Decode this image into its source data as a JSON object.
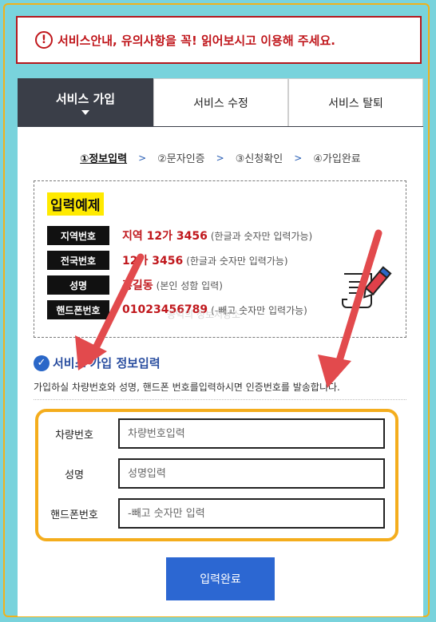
{
  "notice": {
    "icon": "exclamation-circle-icon",
    "text": "서비스안내, 유의사항을 꼭! 읽어보시고 이용해 주세요."
  },
  "tabs": [
    {
      "label": "서비스 가입",
      "active": true
    },
    {
      "label": "서비스 수정",
      "active": false
    },
    {
      "label": "서비스 탈퇴",
      "active": false
    }
  ],
  "steps": [
    {
      "label": "①정보입력",
      "active": true
    },
    {
      "label": "②문자인증",
      "active": false
    },
    {
      "label": "③신청확인",
      "active": false
    },
    {
      "label": "④가입완료",
      "active": false
    }
  ],
  "example": {
    "title": "입력예제",
    "rows": [
      {
        "label": "지역번호",
        "value": "지역 12가 3456",
        "note": "(한글과 숫자만 입력가능)"
      },
      {
        "label": "전국번호",
        "value": "12가 3456",
        "note": "(한글과 숫자만 입력가능)"
      },
      {
        "label": "성명",
        "value": "홍길동",
        "note": "(본인 성함 입력)"
      },
      {
        "label": "핸드폰번호",
        "value": "01023456789",
        "note": "(-빼고 숫자만 입력가능)"
      }
    ],
    "watermark": "공익의 정보저장소"
  },
  "section": {
    "title": "서비스 가입 정보입력",
    "description": "가입하실 차량번호와 성명, 핸드폰 번호를입력하시면 인증번호를 발송합니다."
  },
  "form": {
    "vehicle": {
      "label": "차량번호",
      "placeholder": "차량번호입력"
    },
    "name": {
      "label": "성명",
      "placeholder": "성명입력"
    },
    "phone": {
      "label": "핸드폰번호",
      "placeholder": "-빼고 숫자만 입력"
    },
    "submit_label": "입력완료"
  },
  "colors": {
    "accent": "#c0171c",
    "highlight": "#f4ad1d",
    "button": "#2c67d2",
    "background": "#79d3dc"
  }
}
